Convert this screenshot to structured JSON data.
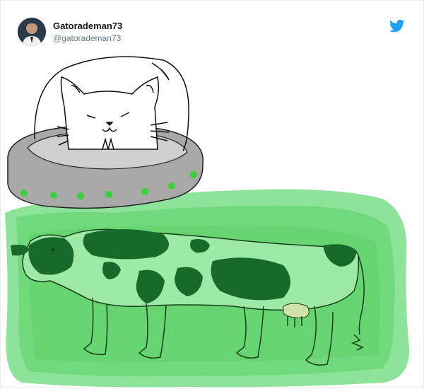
{
  "tweet": {
    "author": {
      "display_name": "Gatorademan73",
      "handle": "@gatorademan73"
    },
    "brand_icon": "twitter-bird-icon",
    "accent_color": "#1da1f2"
  },
  "drawing": {
    "icons": [
      "cat-icon",
      "ufo-icon",
      "cow-icon",
      "tractor-beam-icon"
    ],
    "colors": {
      "beam_outer": "#8ee39a",
      "beam_inner": "#5fd06a",
      "ufo_body": "#a8a8a8",
      "ufo_lights": "#3ecf3e",
      "cow_spots": "#176a2a"
    }
  }
}
